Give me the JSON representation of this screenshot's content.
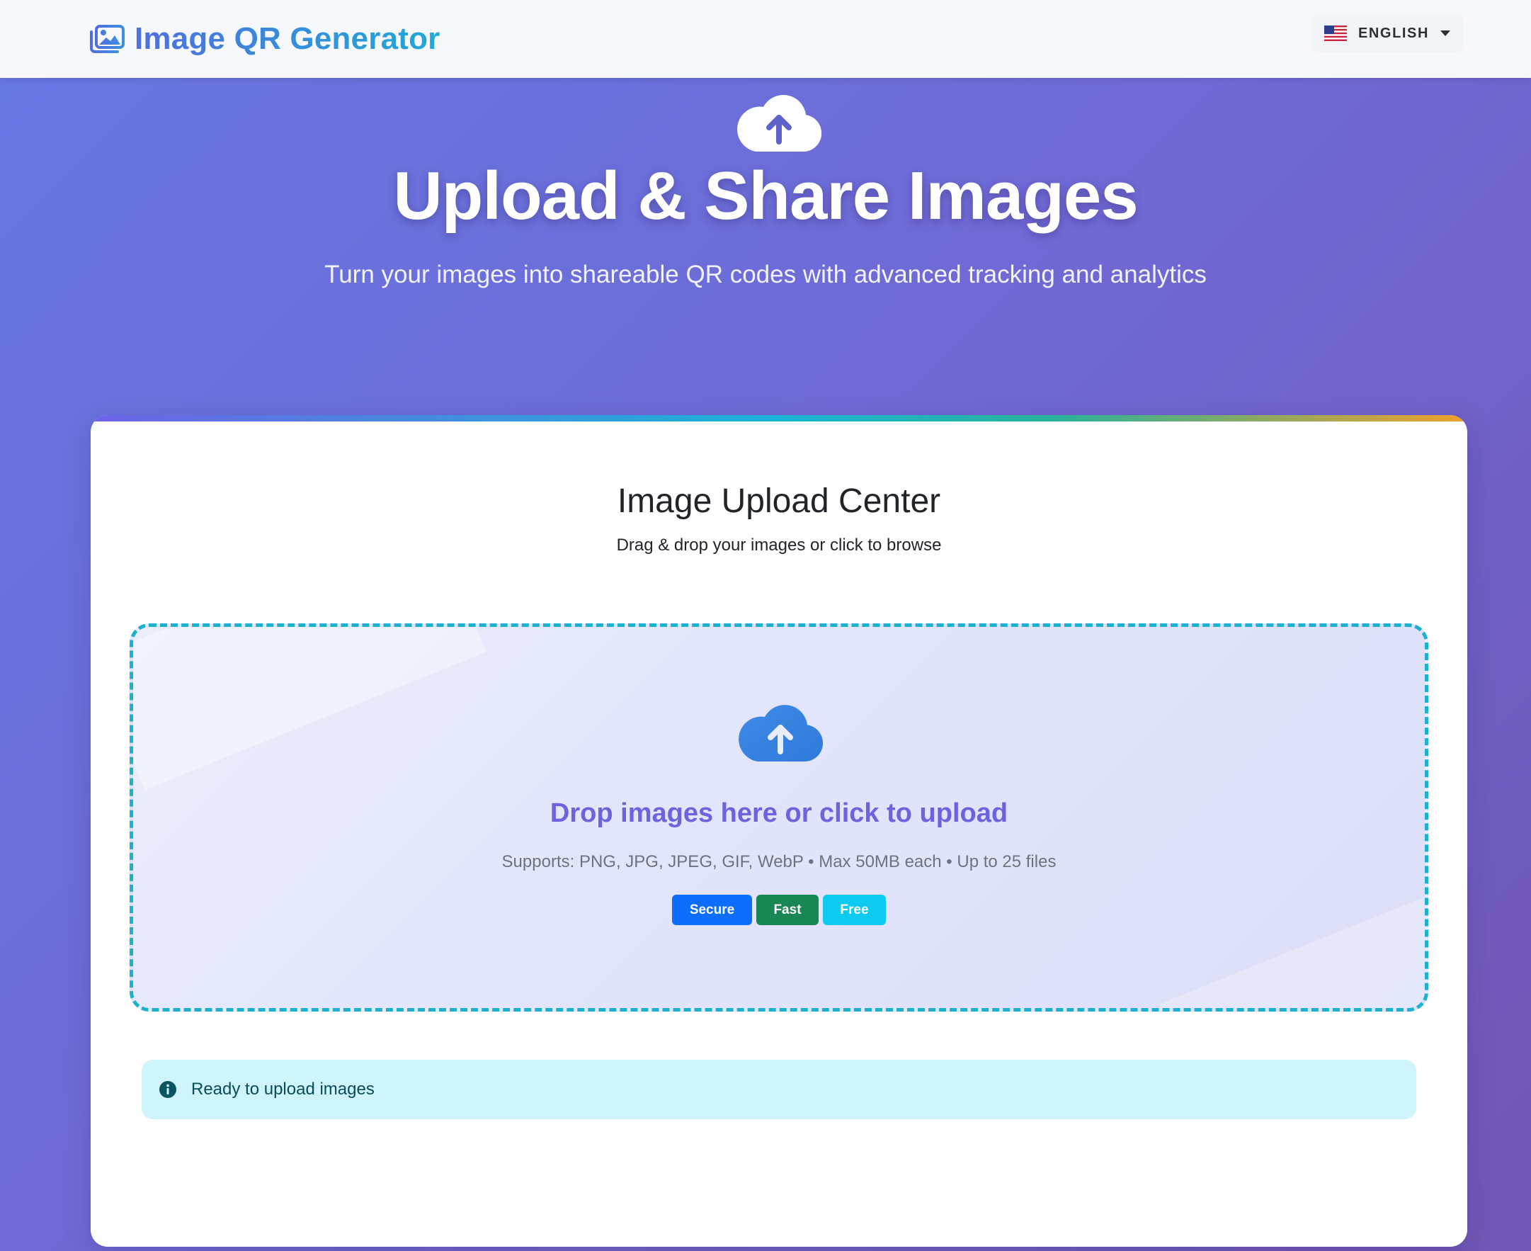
{
  "navbar": {
    "brand_text": "Image QR Generator",
    "language_label": "ENGLISH",
    "language_flag": "us-flag-icon"
  },
  "hero": {
    "icon": "cloud-upload-icon",
    "title": "Upload & Share Images",
    "subtitle": "Turn your images into shareable QR codes with advanced tracking and analytics"
  },
  "upload_card": {
    "title": "Image Upload Center",
    "subtitle": "Drag & drop your images or click to browse",
    "dropzone": {
      "icon": "cloud-upload-icon",
      "title": "Drop images here or click to upload",
      "supports": "Supports: PNG, JPG, JPEG, GIF, WebP • Max 50MB each • Up to 25 files",
      "badges": [
        {
          "label": "Secure",
          "color": "#0d6efd"
        },
        {
          "label": "Fast",
          "color": "#198754"
        },
        {
          "label": "Free",
          "color": "#0dcaf0"
        }
      ]
    },
    "status": {
      "icon": "info-icon",
      "text": "Ready to upload images"
    }
  },
  "colors": {
    "accent": "#6b63e0",
    "dropzone_border": "#1cb2cf",
    "info_bg": "#cff4fc"
  }
}
